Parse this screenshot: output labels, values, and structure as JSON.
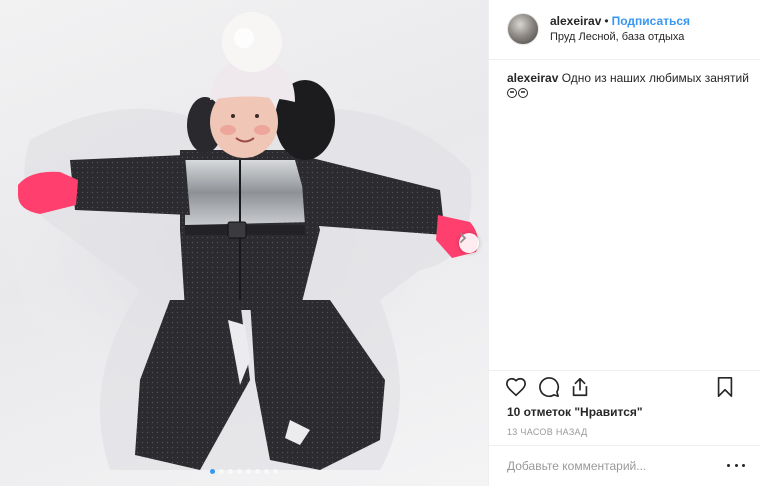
{
  "post": {
    "username": "alexeirav",
    "separator": "•",
    "follow_label": "Подписаться",
    "location": "Пруд Лесной, база отдыха",
    "caption_username": "alexeirav",
    "caption_text": "Одно из наших любимых занятий",
    "likes_text": "10 отметок \"Нравится\"",
    "timestamp": "13 часов назад",
    "comment_placeholder": "Добавьте комментарий..."
  },
  "carousel": {
    "slide_count": 8,
    "active_index": 0
  },
  "icons": {
    "like": "heart-icon",
    "comment": "comment-bubble-icon",
    "share": "share-icon",
    "save": "bookmark-icon",
    "next": "chevron-right-icon",
    "more": "ellipsis-icon"
  },
  "colors": {
    "accent": "#3897f0",
    "text": "#262626",
    "muted": "#999999",
    "divider": "#efefef"
  }
}
